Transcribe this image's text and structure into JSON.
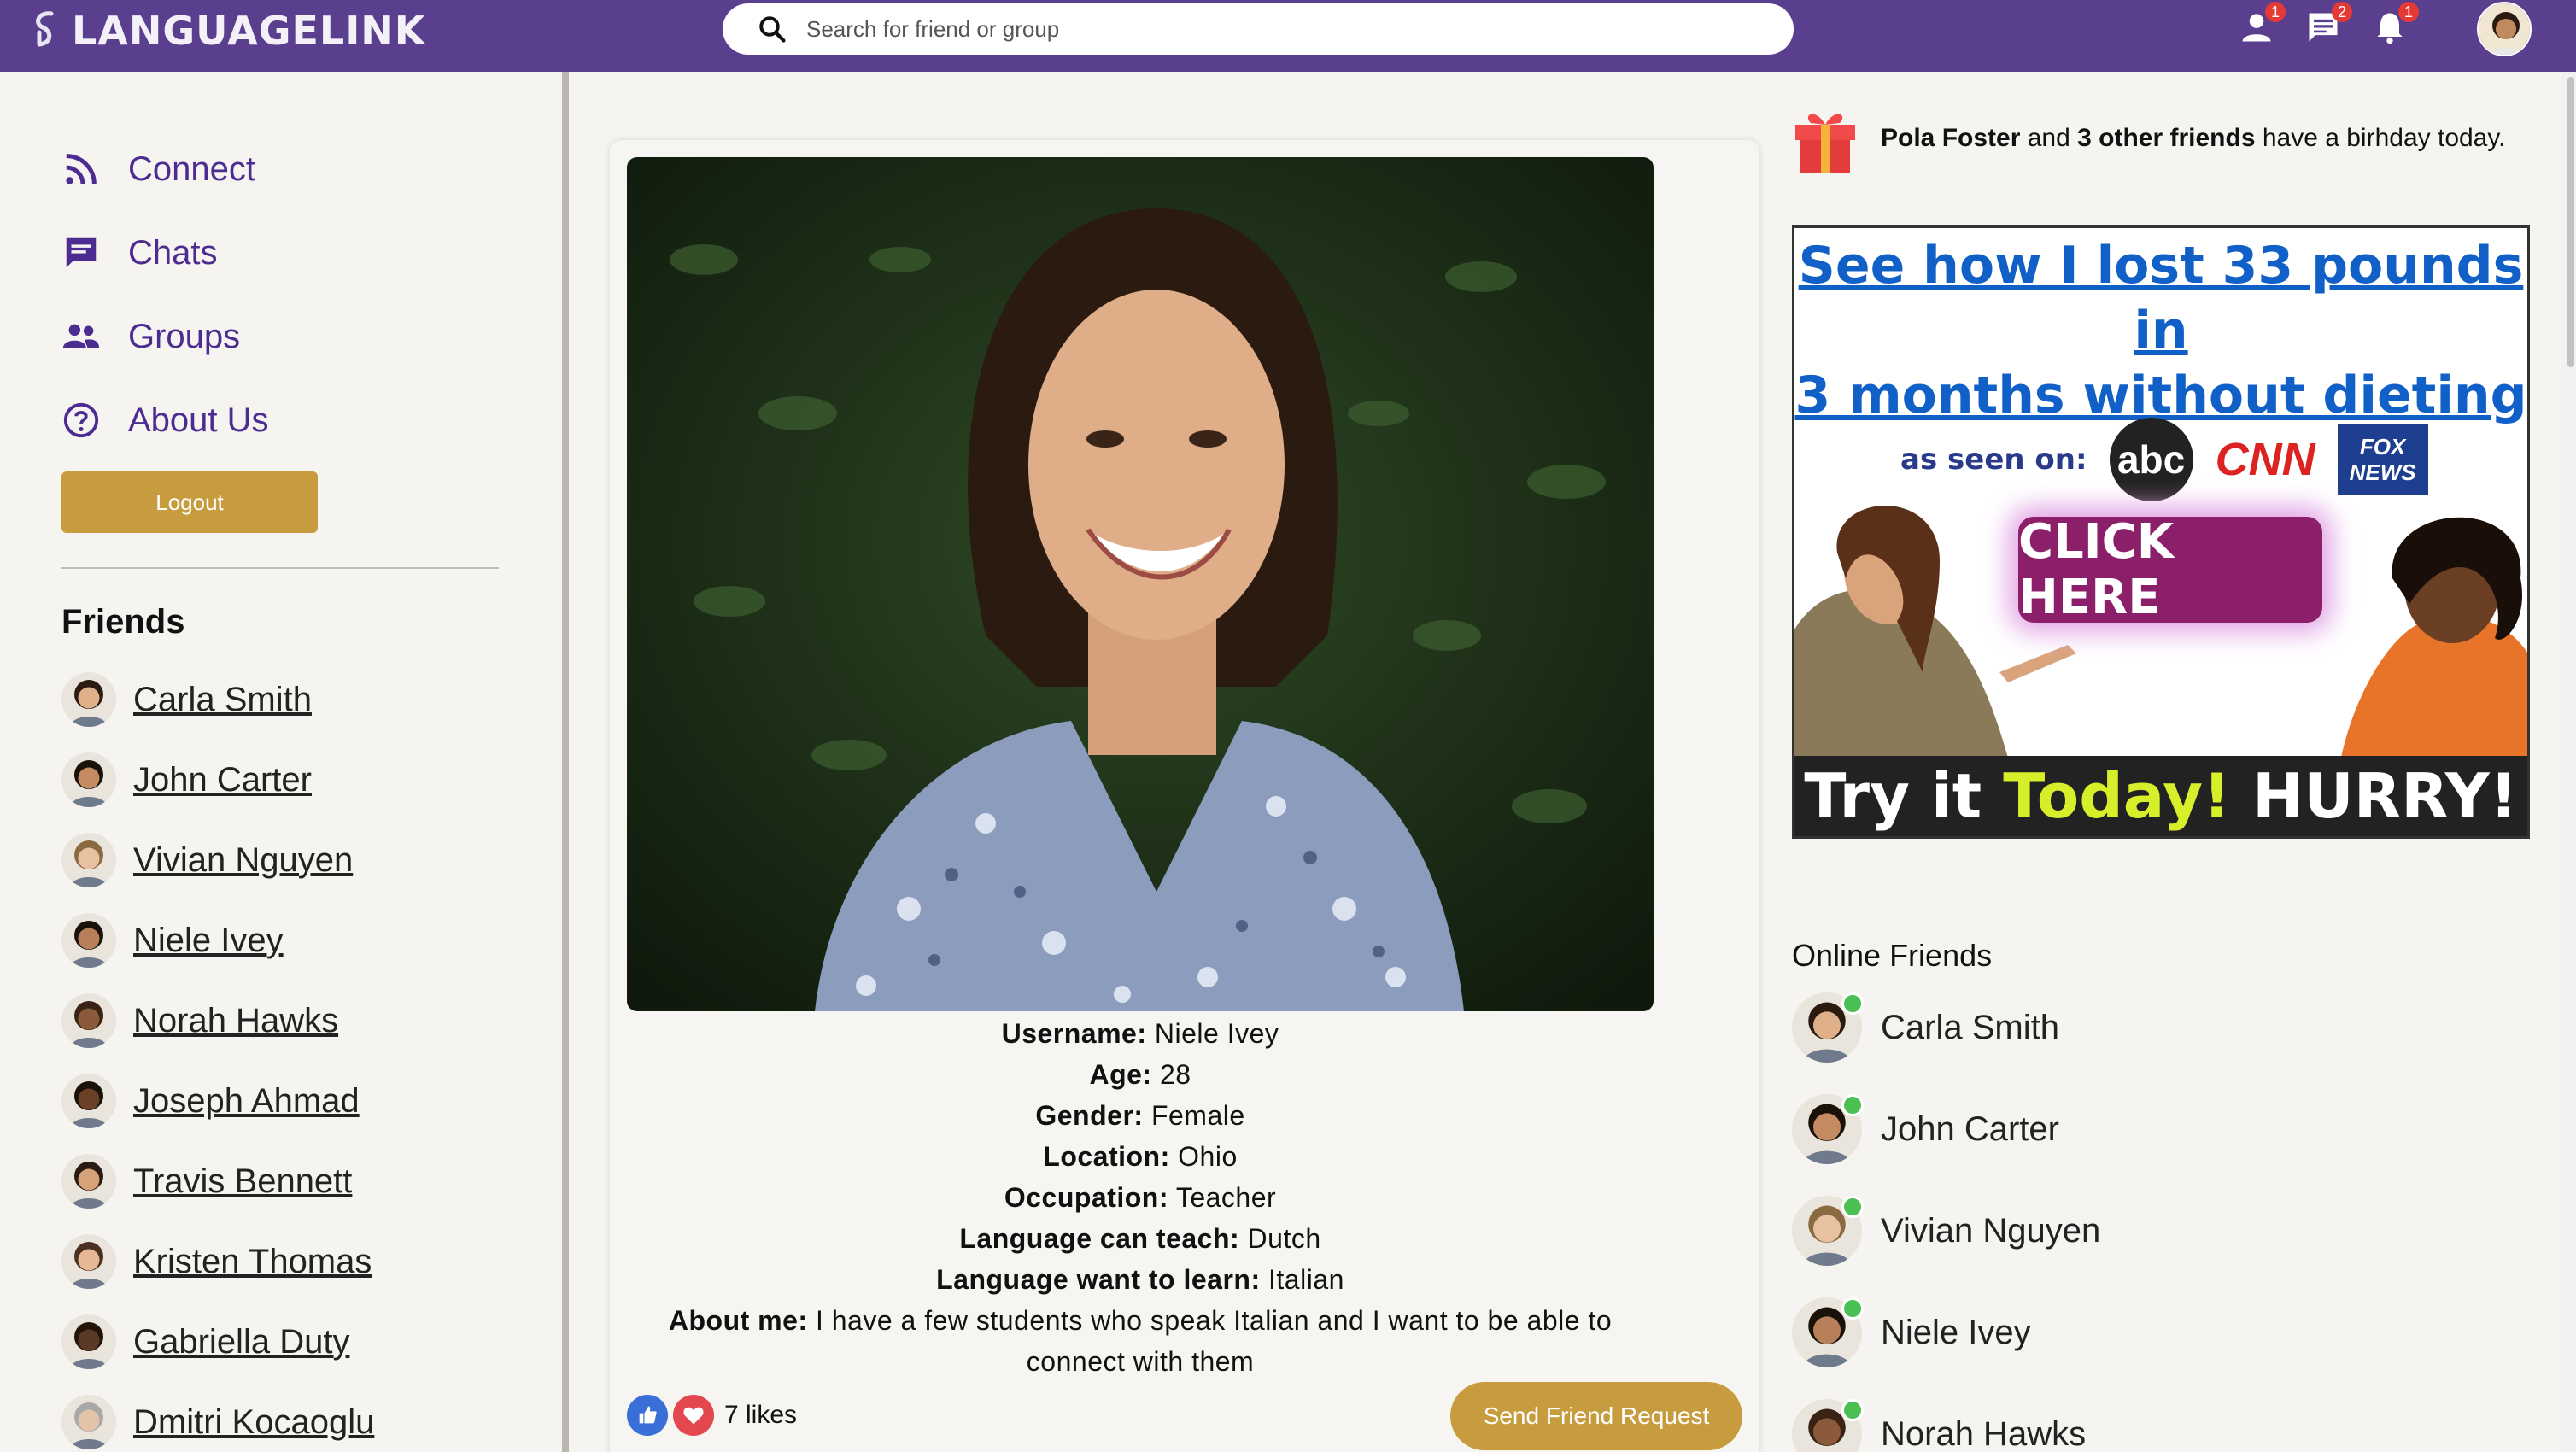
{
  "app": {
    "logo_text": "LANGUAGELINK"
  },
  "search": {
    "placeholder": "Search for friend or group"
  },
  "top_icons": {
    "friend_requests_badge": "1",
    "messages_badge": "2",
    "notifications_badge": "1"
  },
  "nav": {
    "connect": "Connect",
    "chats": "Chats",
    "groups": "Groups",
    "about": "About Us",
    "logout": "Logout"
  },
  "friends": {
    "heading": "Friends",
    "items": [
      "Carla Smith",
      "John Carter",
      "Vivian Nguyen",
      "Niele Ivey",
      "Norah Hawks",
      "Joseph Ahmad",
      "Travis Bennett",
      "Kristen Thomas",
      "Gabriella Duty",
      "Dmitri Kocaoglu"
    ]
  },
  "profile": {
    "labels": {
      "username": "Username:",
      "age": "Age:",
      "gender": "Gender:",
      "location": "Location:",
      "occupation": "Occupation:",
      "can_teach": "Language can teach:",
      "want_learn": "Language want to learn:",
      "about": "About me:"
    },
    "values": {
      "username": "Niele Ivey",
      "age": "28",
      "gender": "Female",
      "location": "Ohio",
      "occupation": "Teacher",
      "can_teach": "Dutch",
      "want_learn": "Italian",
      "about": "I have a few students who speak Italian and I want to be able to connect with them"
    },
    "likes": "7 likes",
    "send_request": "Send Friend Request"
  },
  "birthday": {
    "name": "Pola Foster",
    "and": "and",
    "others": "3 other friends",
    "rest": "have a birhday today."
  },
  "ad": {
    "headline_1": "See how I lost 33 pounds in",
    "headline_2": "3 months without dieting",
    "seen_on": "as seen on:",
    "logo_abc": "abc",
    "logo_cnn": "CNN",
    "logo_fox": "FOX NEWS",
    "click_here": "CLICK HERE",
    "bottom_1": "Try it",
    "bottom_2": "Today!",
    "bottom_3": "HURRY!"
  },
  "online": {
    "heading": "Online Friends",
    "items": [
      "Carla Smith",
      "John Carter",
      "Vivian Nguyen",
      "Niele Ivey",
      "Norah Hawks"
    ]
  },
  "colors": {
    "brand_purple": "#5a3f8f",
    "nav_purple": "#4d2c91",
    "gold": "#c69c3e",
    "online_green": "#4ac052"
  }
}
